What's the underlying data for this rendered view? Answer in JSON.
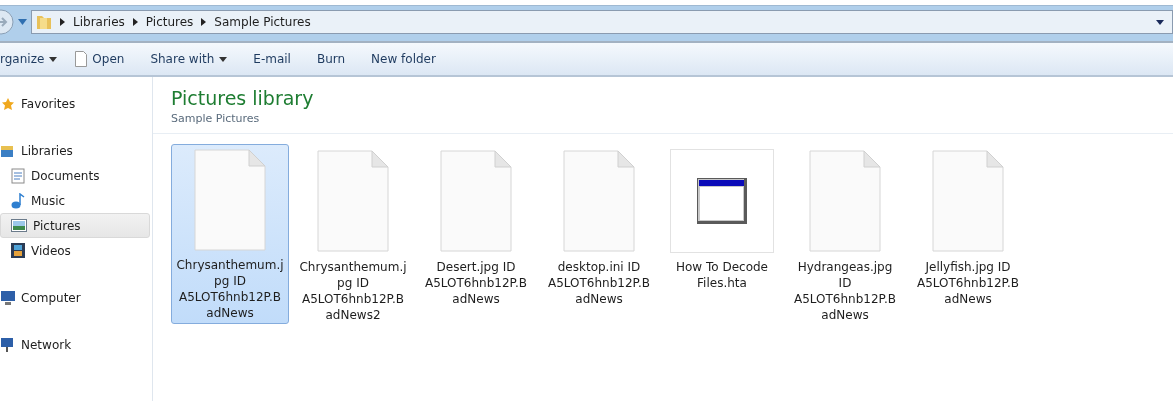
{
  "address_bar": {
    "breadcrumbs": [
      "Libraries",
      "Pictures",
      "Sample Pictures"
    ]
  },
  "toolbar": [
    {
      "label": "rganize",
      "kind": "menu"
    },
    {
      "label": "Open",
      "kind": "open"
    },
    {
      "label": "Share with",
      "kind": "menu"
    },
    {
      "label": "E-mail",
      "kind": "plain"
    },
    {
      "label": "Burn",
      "kind": "plain"
    },
    {
      "label": "New folder",
      "kind": "plain"
    }
  ],
  "sidebar": {
    "groups": [
      {
        "label": "Favorites"
      },
      {
        "label": "Libraries",
        "children": [
          {
            "label": "Documents",
            "selected": false
          },
          {
            "label": "Music",
            "selected": false
          },
          {
            "label": "Pictures",
            "selected": true
          },
          {
            "label": "Videos",
            "selected": false
          }
        ]
      },
      {
        "label": "Computer"
      },
      {
        "label": "Network"
      }
    ]
  },
  "content": {
    "title": "Pictures library",
    "subtitle": "Sample Pictures",
    "files": [
      {
        "name": "Chrysanthemum.jpg ID A5LOT6hnb12P.BadNews",
        "kind": "blank",
        "selected": true
      },
      {
        "name": "Chrysanthemum.jpg ID A5LOT6hnb12P.BadNews2",
        "kind": "blank",
        "selected": false
      },
      {
        "name": "Desert.jpg ID A5LOT6hnb12P.BadNews",
        "kind": "blank",
        "selected": false
      },
      {
        "name": "desktop.ini ID A5LOT6hnb12P.BadNews",
        "kind": "blank",
        "selected": false
      },
      {
        "name": "How To Decode Files.hta",
        "kind": "app",
        "selected": false
      },
      {
        "name": "Hydrangeas.jpg ID A5LOT6hnb12P.BadNews",
        "kind": "blank",
        "selected": false
      },
      {
        "name": "Jellyfish.jpg ID A5LOT6hnb12P.BadNews",
        "kind": "blank",
        "selected": false
      }
    ]
  }
}
